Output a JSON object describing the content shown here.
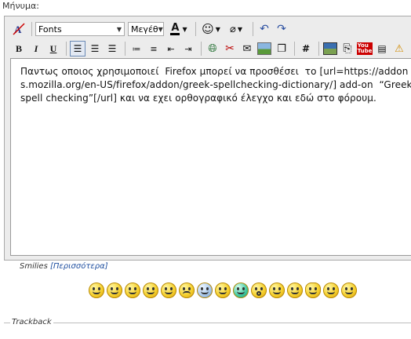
{
  "form": {
    "label": "Μήνυμα:"
  },
  "toolbar": {
    "font_select": "Fonts",
    "size_select": "Μεγέθ",
    "bold": "B",
    "italic": "I",
    "underline": "U",
    "hash": "#",
    "youtube": "You Tube"
  },
  "editor": {
    "content": "Παντως οποιος χρησιμοποιεί  Firefox μπορεί να προσθέσει  το [url=https://addons.mozilla.org/en-US/firefox/addon/greek-spellchecking-dictionary/] add-on  “Greek spell checking”[/url] και να εχει ορθογραφικό έλεγχο και εδώ στο φόρουμ."
  },
  "smilies": {
    "label": "Smilies",
    "more_link": "[Περισσότερα]",
    "icons": [
      "mad",
      "tongue",
      "smile",
      "grin",
      "laugh",
      "sad",
      "cool-blue",
      "sunglasses",
      "teeth",
      "shocked",
      "lol",
      "rolleyes",
      "rockon",
      "wink",
      "question"
    ]
  },
  "trackback": {
    "label": "Trackback"
  },
  "colors": {
    "accent_link": "#1f4fa0"
  }
}
